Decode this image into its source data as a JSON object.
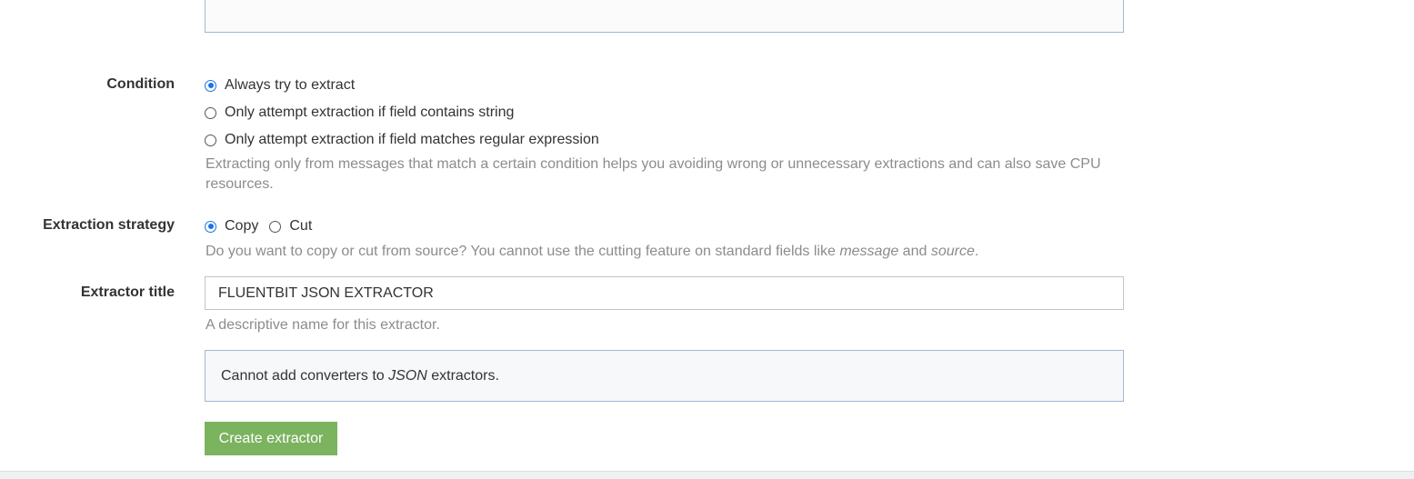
{
  "condition": {
    "label": "Condition",
    "options": [
      {
        "label": "Always try to extract",
        "checked": true
      },
      {
        "label": "Only attempt extraction if field contains string",
        "checked": false
      },
      {
        "label": "Only attempt extraction if field matches regular expression",
        "checked": false
      }
    ],
    "help": "Extracting only from messages that match a certain condition helps you avoiding wrong or unnecessary extractions and can also save CPU resources."
  },
  "strategy": {
    "label": "Extraction strategy",
    "options": [
      {
        "label": "Copy",
        "checked": true
      },
      {
        "label": "Cut",
        "checked": false
      }
    ],
    "help_prefix": "Do you want to copy or cut from source? You cannot use the cutting feature on standard fields like ",
    "help_message": "message",
    "help_and": " and ",
    "help_source": "source",
    "help_suffix": "."
  },
  "title_field": {
    "label": "Extractor title",
    "value": "FLUENTBIT JSON EXTRACTOR",
    "help": "A descriptive name for this extractor."
  },
  "converters_note": {
    "prefix": "Cannot add converters to ",
    "type": "JSON",
    "suffix": " extractors."
  },
  "actions": {
    "create_label": "Create extractor"
  },
  "colors": {
    "accent": "#1a73e8",
    "button": "#7bb35f",
    "help_text": "#8c8c8c"
  }
}
